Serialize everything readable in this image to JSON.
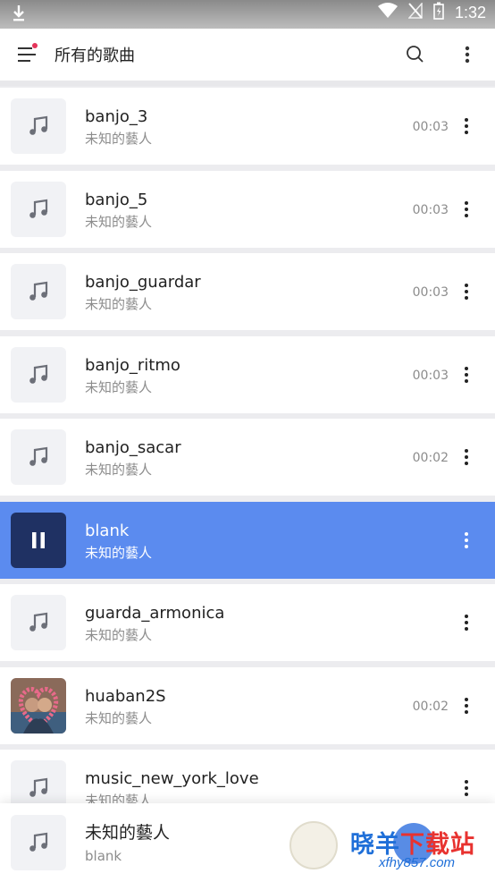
{
  "status_bar": {
    "time": "1:32"
  },
  "app_bar": {
    "title": "所有的歌曲"
  },
  "songs": [
    {
      "name": "banjo_3",
      "artist": "未知的藝人",
      "duration": "00:03",
      "thumb": "music-note",
      "playing": false
    },
    {
      "name": "banjo_5",
      "artist": "未知的藝人",
      "duration": "00:03",
      "thumb": "music-note",
      "playing": false
    },
    {
      "name": "banjo_guardar",
      "artist": "未知的藝人",
      "duration": "00:03",
      "thumb": "music-note",
      "playing": false
    },
    {
      "name": "banjo_ritmo",
      "artist": "未知的藝人",
      "duration": "00:03",
      "thumb": "music-note",
      "playing": false
    },
    {
      "name": "banjo_sacar",
      "artist": "未知的藝人",
      "duration": "00:02",
      "thumb": "music-note",
      "playing": false
    },
    {
      "name": "blank",
      "artist": "未知的藝人",
      "duration": "",
      "thumb": "pause",
      "playing": true
    },
    {
      "name": "guarda_armonica",
      "artist": "未知的藝人",
      "duration": "",
      "thumb": "music-note",
      "playing": false
    },
    {
      "name": "huaban2S",
      "artist": "未知的藝人",
      "duration": "00:02",
      "thumb": "photo",
      "playing": false
    },
    {
      "name": "music_new_york_love",
      "artist": "未知的藝人",
      "duration": "",
      "thumb": "music-note",
      "playing": false
    }
  ],
  "now_playing": {
    "title": "未知的藝人",
    "subtitle": "blank"
  },
  "watermark": {
    "text_a": "晓羊",
    "text_b": "下载站",
    "url": "xfhy857.com"
  },
  "colors": {
    "accent": "#5b8bef",
    "playing_thumb": "#1f3163",
    "notification_dot": "#e5345a"
  }
}
